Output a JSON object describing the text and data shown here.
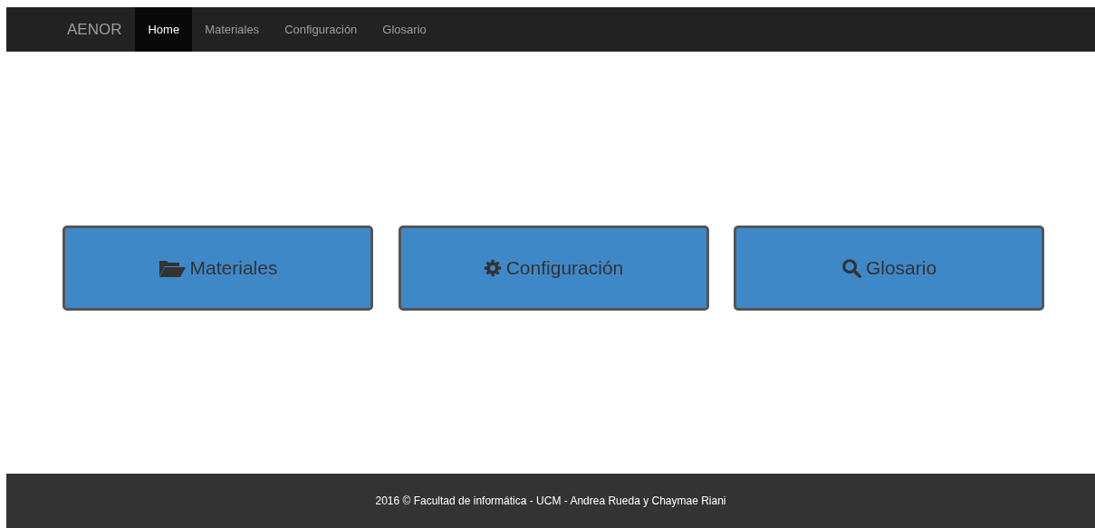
{
  "navbar": {
    "brand": "AENOR",
    "items": [
      {
        "label": "Home",
        "selected": true
      },
      {
        "label": "Materiales",
        "selected": false
      },
      {
        "label": "Configuración",
        "selected": false
      },
      {
        "label": "Glosario",
        "selected": false
      }
    ]
  },
  "tiles": [
    {
      "label": "Materiales",
      "kind": "folder"
    },
    {
      "label": "Configuración",
      "kind": "gear"
    },
    {
      "label": "Glosario",
      "kind": "search"
    }
  ],
  "footer": {
    "text": "2016 © Facultad de informática - UCM - Andrea Rueda y Chaymae Riani"
  }
}
